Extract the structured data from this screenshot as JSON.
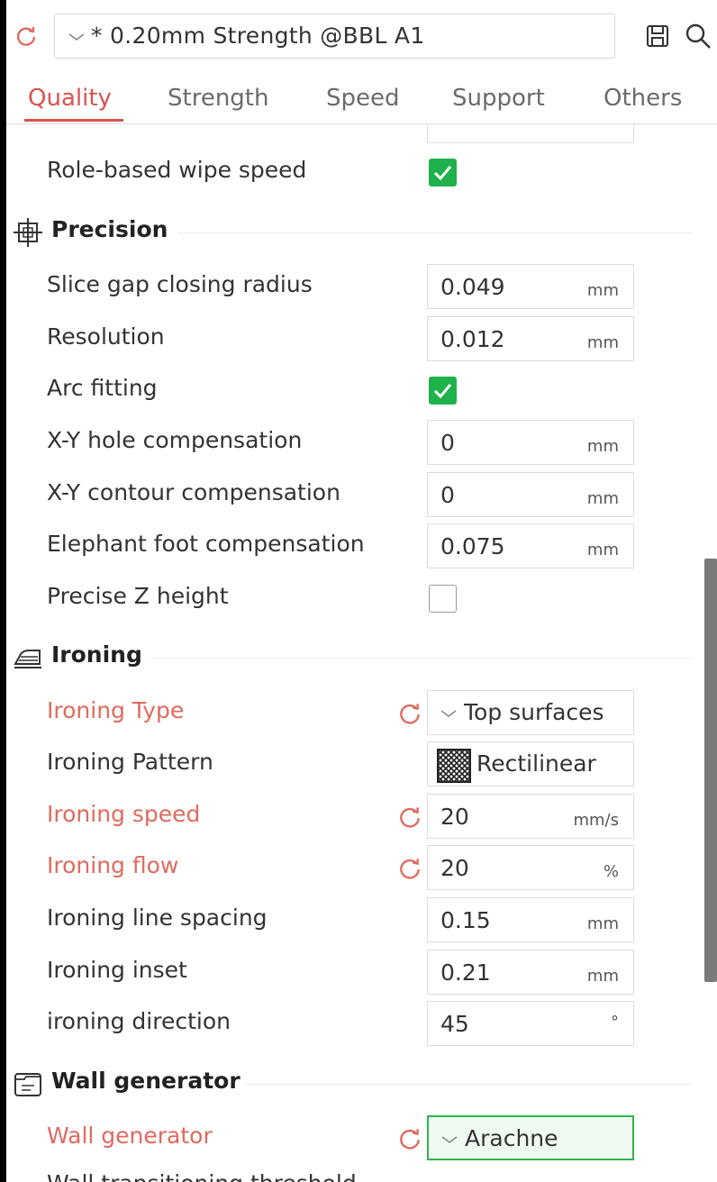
{
  "header": {
    "preset_name": "* 0.20mm Strength @BBL A1",
    "icons": [
      "reset-arrow-icon",
      "chevron-down-icon",
      "save-icon",
      "search-icon"
    ]
  },
  "tabs": [
    {
      "label": "Quality",
      "active": true
    },
    {
      "label": "Strength",
      "active": false
    },
    {
      "label": "Speed",
      "active": false
    },
    {
      "label": "Support",
      "active": false
    },
    {
      "label": "Others",
      "active": false
    }
  ],
  "settings": {
    "partial_label": "· · ·",
    "role_based_wipe_speed": {
      "label": "Role-based wipe speed",
      "checked": true
    },
    "precision": {
      "title": "Precision",
      "slice_gap": {
        "label": "Slice gap closing radius",
        "value": "0.049",
        "unit": "mm"
      },
      "resolution": {
        "label": "Resolution",
        "value": "0.012",
        "unit": "mm"
      },
      "arc_fitting": {
        "label": "Arc fitting",
        "checked": true
      },
      "xy_hole": {
        "label": "X-Y hole compensation",
        "value": "0",
        "unit": "mm"
      },
      "xy_contour": {
        "label": "X-Y contour compensation",
        "value": "0",
        "unit": "mm"
      },
      "elephant_foot": {
        "label": "Elephant foot compensation",
        "value": "0.075",
        "unit": "mm"
      },
      "precise_z": {
        "label": "Precise Z height",
        "checked": false
      }
    },
    "ironing": {
      "title": "Ironing",
      "type": {
        "label": "Ironing Type",
        "value": "Top surfaces",
        "modified": true
      },
      "pattern": {
        "label": "Ironing Pattern",
        "value": "Rectilinear"
      },
      "speed": {
        "label": "Ironing speed",
        "value": "20",
        "unit": "mm/s",
        "modified": true
      },
      "flow": {
        "label": "Ironing flow",
        "value": "20",
        "unit": "%",
        "modified": true
      },
      "line_spacing": {
        "label": "Ironing line spacing",
        "value": "0.15",
        "unit": "mm"
      },
      "inset": {
        "label": "Ironing inset",
        "value": "0.21",
        "unit": "mm"
      },
      "direction": {
        "label": "ironing direction",
        "value": "45",
        "unit": "°"
      }
    },
    "wall_generator": {
      "title": "Wall generator",
      "generator": {
        "label": "Wall generator",
        "value": "Arachne",
        "modified": true
      },
      "next_cut_label": "Wall transitioning threshold"
    }
  },
  "colors": {
    "accent": "#d9534f",
    "modified_label": "#e06a5f",
    "check_green": "#1fb14b"
  }
}
